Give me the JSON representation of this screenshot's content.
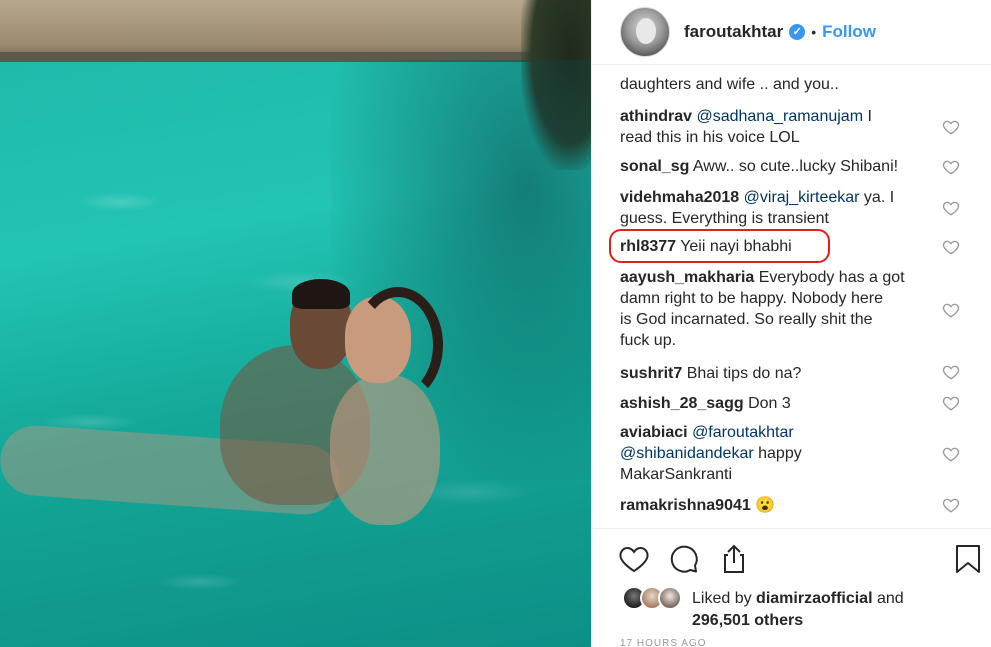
{
  "post": {
    "username": "faroutakhtar",
    "verified_mark": "✓",
    "separator": "•",
    "follow_label": "Follow"
  },
  "comments": [
    {
      "lines": [
        "daughters and wife .. and you.."
      ]
    },
    {
      "user": "athindrav",
      "mention": "@sadhana_ramanujam",
      "text_inline": " I",
      "lines": [
        "read this in his voice LOL"
      ]
    },
    {
      "user": "sonal_sg",
      "text_inline": " Aww.. so cute..lucky Shibani!"
    },
    {
      "user": "videhmaha2018",
      "mention": "@viraj_kirteekar",
      "text_inline": " ya. I",
      "lines": [
        "guess. Everything is transient"
      ]
    },
    {
      "user": "rhl8377",
      "text_inline": " Yeii nayi bhabhi"
    },
    {
      "user": "aayush_makharia",
      "text_inline": " Everybody has a got",
      "lines": [
        "damn right to be happy. Nobody here",
        "is God incarnated. So really shit the",
        "fuck up."
      ]
    },
    {
      "user": "sushrit7",
      "text_inline": " Bhai tips do na?"
    },
    {
      "user": "ashish_28_sagg",
      "text_inline": " Don 3"
    },
    {
      "user": "aviabiaci",
      "mention": "@faroutakhtar",
      "lines_mention": "@shibanidandekar",
      "lines_after_mention": " happy",
      "lines": [
        "MakarSankranti"
      ]
    },
    {
      "user": "ramakrishna9041",
      "emoji": "😮"
    }
  ],
  "likes": {
    "prefix": "Liked by ",
    "by_user": "diamirzaofficial",
    "and": " and",
    "others": "296,501 others"
  },
  "timestamp": "17 HOURS AGO",
  "icons": {
    "verified": "verified-badge-icon",
    "like": "heart-icon",
    "comment": "comment-bubble-icon",
    "share": "share-icon",
    "save": "bookmark-icon"
  },
  "colors": {
    "link": "#3897f0",
    "mention": "#003569",
    "highlight": "#e0201f",
    "pool": "#22c4b4"
  }
}
